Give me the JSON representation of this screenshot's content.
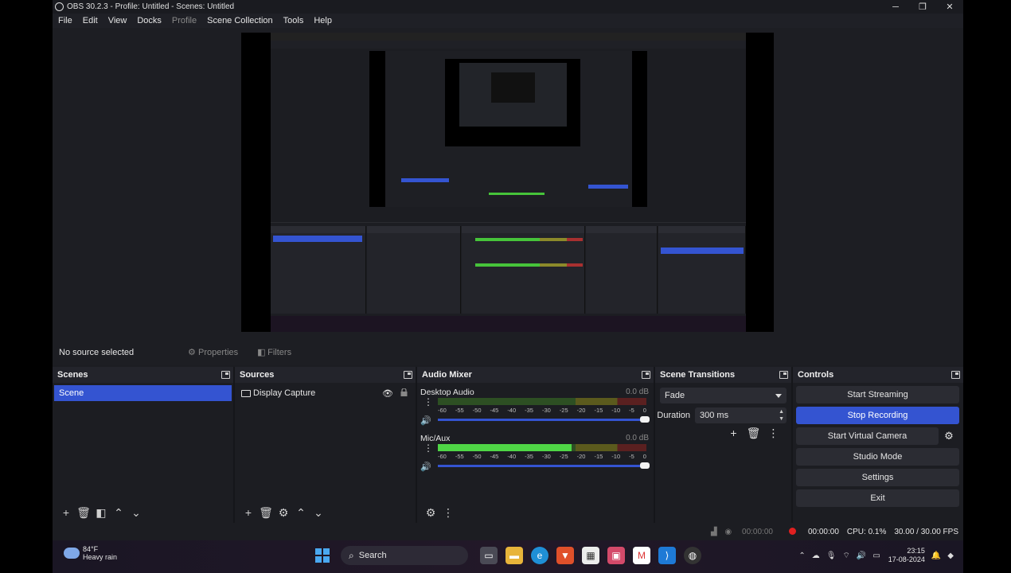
{
  "window": {
    "title": "OBS 30.2.3 - Profile: Untitled - Scenes: Untitled"
  },
  "menu": [
    "File",
    "Edit",
    "View",
    "Docks",
    "Profile",
    "Scene Collection",
    "Tools",
    "Help"
  ],
  "info": {
    "no_source": "No source selected",
    "properties": "Properties",
    "filters": "Filters"
  },
  "docks": {
    "scenes": {
      "title": "Scenes",
      "items": [
        "Scene"
      ]
    },
    "sources": {
      "title": "Sources",
      "items": [
        "Display Capture"
      ]
    },
    "mixer": {
      "title": "Audio Mixer",
      "channels": [
        {
          "name": "Desktop Audio",
          "db": "0.0 dB",
          "level": 0.0
        },
        {
          "name": "Mic/Aux",
          "db": "0.0 dB",
          "level": 0.64
        }
      ],
      "ticks": [
        "-60",
        "-55",
        "-50",
        "-45",
        "-40",
        "-35",
        "-30",
        "-25",
        "-20",
        "-15",
        "-10",
        "-5",
        "0"
      ]
    },
    "transitions": {
      "title": "Scene Transitions",
      "selected": "Fade",
      "duration_label": "Duration",
      "duration": "300 ms"
    },
    "controls": {
      "title": "Controls",
      "start_streaming": "Start Streaming",
      "stop_recording": "Stop Recording",
      "start_virtual_camera": "Start Virtual Camera",
      "studio_mode": "Studio Mode",
      "settings": "Settings",
      "exit": "Exit"
    }
  },
  "status": {
    "stream_time": "00:00:00",
    "rec_time": "00:00:00",
    "cpu": "CPU: 0.1%",
    "fps": "30.00 / 30.00 FPS"
  },
  "taskbar": {
    "temp": "84°F",
    "weather": "Heavy rain",
    "search": "Search",
    "time": "23:15",
    "date": "17-08-2024"
  },
  "colors": {
    "accent": "#3454d1",
    "record": "#e02020",
    "meter_green": "#4fd646"
  }
}
